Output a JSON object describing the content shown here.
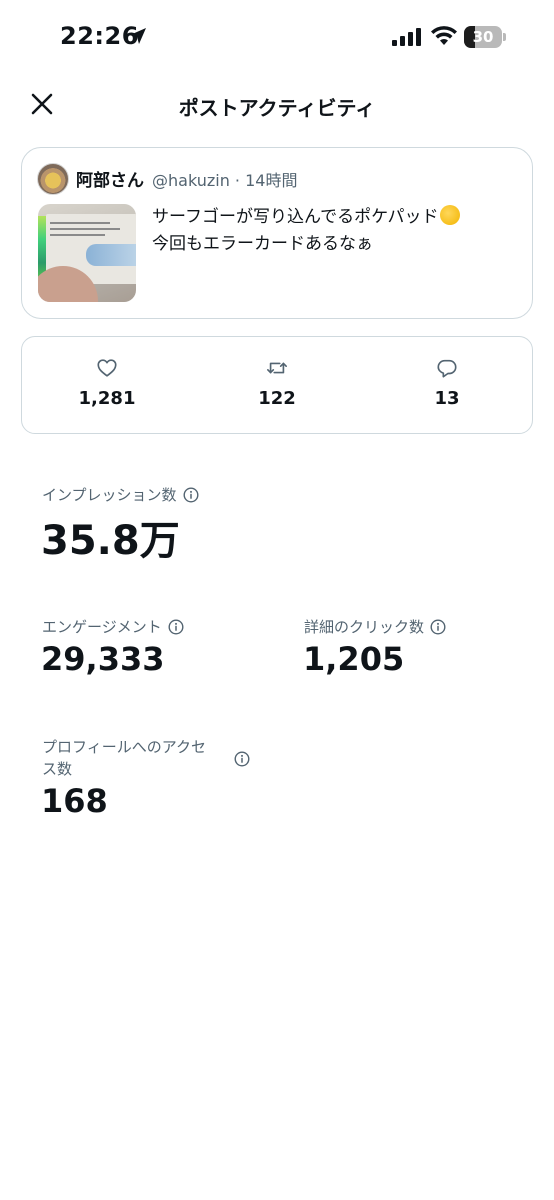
{
  "status_bar": {
    "time": "22:26",
    "battery": "30",
    "battery_level": 0.3,
    "icons": [
      "location-arrow-icon",
      "cellular-signal-icon",
      "wifi-icon",
      "battery-icon"
    ]
  },
  "header": {
    "title": "ポストアクティビティ",
    "close_icon": "close-icon"
  },
  "tweet": {
    "author_name": "阿部さん",
    "handle": "@hakuzin",
    "separator": " · ",
    "time_ago": "14時間",
    "text_line1": "サーフゴーが写り込んでるポケパッド",
    "emoji": "thinking-face-emoji",
    "text_line2": "今回もエラーカードあるなぁ"
  },
  "engagement": {
    "likes": "1,281",
    "reposts": "122",
    "replies": "13"
  },
  "metrics": {
    "impressions_label": "インプレッション数",
    "impressions_value": "35.8万",
    "engagements_label": "エンゲージメント",
    "engagements_value": "29,333",
    "detail_clicks_label": "詳細のクリック数",
    "detail_clicks_value": "1,205",
    "profile_visits_label_line1": "プロフィールへのアクセ",
    "profile_visits_label_line2": "ス数",
    "profile_visits_value": "168"
  },
  "colors": {
    "text_primary": "#0f1419",
    "text_secondary": "#536471",
    "border": "#cfd9de",
    "background": "#ffffff"
  }
}
